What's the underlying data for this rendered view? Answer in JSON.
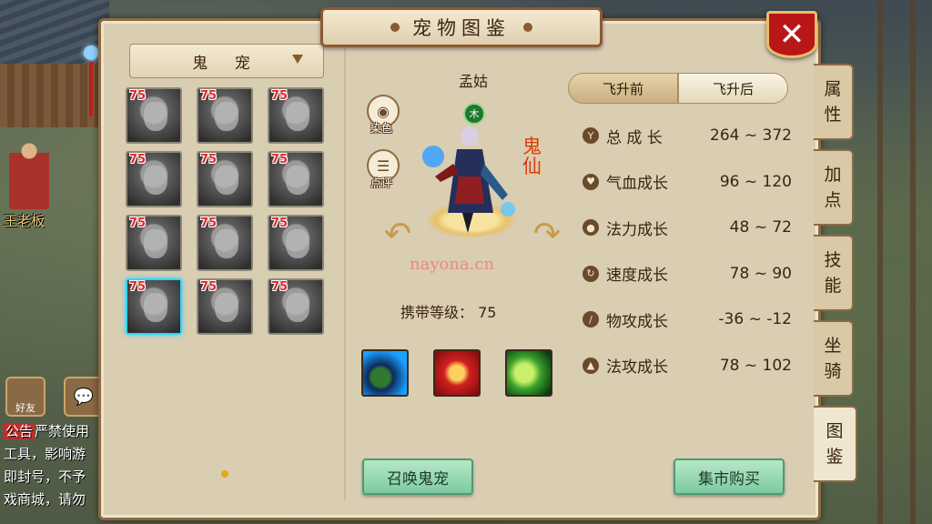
{
  "window": {
    "title": "宠物图鉴",
    "close_label": "✕"
  },
  "background": {
    "npc_name": "王老板",
    "buttons": [
      {
        "label": "好友",
        "icon": "handshake-icon"
      },
      {
        "label": "",
        "icon": "chat-bubble-icon"
      }
    ],
    "chat": {
      "tag": "公告",
      "lines": [
        "严禁使用",
        "工具，影响游",
        "即封号，不予",
        "戏商城，请勿"
      ]
    }
  },
  "filter": {
    "selected": "鬼 宠"
  },
  "pet_list": [
    {
      "level": "75"
    },
    {
      "level": "75"
    },
    {
      "level": "75"
    },
    {
      "level": "75"
    },
    {
      "level": "75"
    },
    {
      "level": "75"
    },
    {
      "level": "75"
    },
    {
      "level": "75"
    },
    {
      "level": "75"
    },
    {
      "level": "75",
      "selected": true
    },
    {
      "level": "75"
    },
    {
      "level": "75"
    }
  ],
  "pet": {
    "name": "孟姑",
    "element": "木",
    "species": "鬼仙",
    "dye_label": "染色",
    "review_label": "点评",
    "carry_level": "携带等级： 75",
    "skills": [
      "skill-1",
      "skill-2",
      "skill-3"
    ]
  },
  "watermark": "nayona.cn",
  "ascension": {
    "before": "飞升前",
    "after": "飞升后",
    "active": "before"
  },
  "stats": [
    {
      "name": "总 成 长",
      "value": "264 ~ 372",
      "icon": "growth-icon"
    },
    {
      "name": "气血成长",
      "value": "96 ~ 120",
      "icon": "heart-icon"
    },
    {
      "name": "法力成长",
      "value": "48 ~ 72",
      "icon": "mana-drop-icon"
    },
    {
      "name": "速度成长",
      "value": "78 ~ 90",
      "icon": "speed-icon"
    },
    {
      "name": "物攻成长",
      "value": "-36 ~ -12",
      "icon": "sword-icon"
    },
    {
      "name": "法攻成长",
      "value": "78 ~ 102",
      "icon": "flame-icon"
    }
  ],
  "buttons": {
    "summon": "召唤鬼宠",
    "market": "集市购买"
  },
  "side_tabs": [
    {
      "label": "属性"
    },
    {
      "label": "加点"
    },
    {
      "label": "技能"
    },
    {
      "label": "坐骑"
    },
    {
      "label": "图鉴",
      "active": true
    }
  ]
}
